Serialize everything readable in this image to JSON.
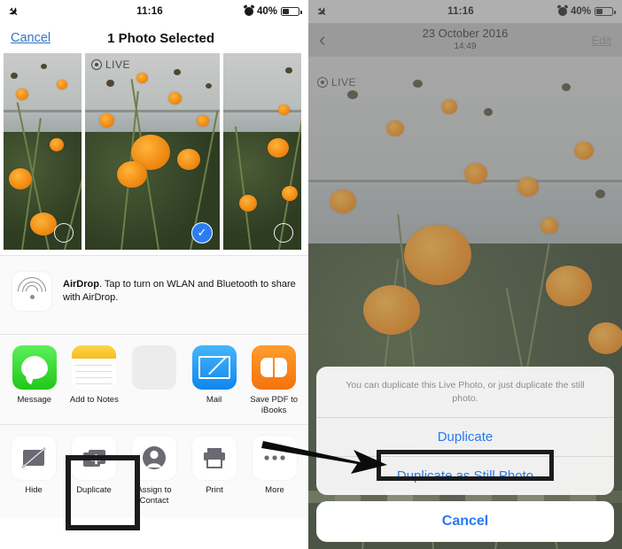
{
  "left_phone": {
    "status_bar": {
      "airplane_icon": "airplane-icon",
      "time": "11:16",
      "alarm_icon": "alarm-icon",
      "battery_percent": "40%",
      "battery_level": 40
    },
    "nav": {
      "cancel_label": "Cancel",
      "title": "1 Photo Selected"
    },
    "thumbnails": [
      {
        "name": "thumb-left",
        "selected": false,
        "live": false
      },
      {
        "name": "thumb-center",
        "selected": true,
        "live": true,
        "live_label": "LIVE"
      },
      {
        "name": "thumb-right",
        "selected": false,
        "live": false
      }
    ],
    "airdrop": {
      "title": "AirDrop",
      "description": ". Tap to turn on WLAN and Bluetooth to share with AirDrop.",
      "icon": "airdrop-icon"
    },
    "apps": [
      {
        "label": "Message",
        "icon": "message-icon"
      },
      {
        "label": "Add to Notes",
        "icon": "notes-icon"
      },
      {
        "label": "",
        "icon": "blank-app-icon"
      },
      {
        "label": "Mail",
        "icon": "mail-icon"
      },
      {
        "label": "Save PDF to iBooks",
        "icon": "ibooks-icon"
      }
    ],
    "actions": [
      {
        "label": "Hide",
        "icon": "hide-icon",
        "highlighted": false
      },
      {
        "label": "Duplicate",
        "icon": "duplicate-icon",
        "highlighted": true
      },
      {
        "label": "Assign to Contact",
        "icon": "contact-icon",
        "highlighted": false
      },
      {
        "label": "Print",
        "icon": "print-icon",
        "highlighted": false
      },
      {
        "label": "More",
        "icon": "more-icon",
        "highlighted": false
      }
    ]
  },
  "right_phone": {
    "status_bar": {
      "airplane_icon": "airplane-icon",
      "time": "11:16",
      "alarm_icon": "alarm-icon",
      "battery_percent": "40%",
      "battery_level": 40
    },
    "nav": {
      "back_icon": "chevron-left-icon",
      "date": "23 October 2016",
      "time": "14:49",
      "edit_label": "Edit"
    },
    "live_badge": "LIVE",
    "action_sheet": {
      "message": "You can duplicate this Live Photo, or just duplicate the still photo.",
      "options": [
        {
          "label": "Duplicate",
          "highlighted": false
        },
        {
          "label": "Duplicate as Still Photo",
          "highlighted": true
        }
      ],
      "cancel_label": "Cancel"
    }
  },
  "annotation": {
    "arrow": "pointer-arrow",
    "highlight_color": "#1b1b1b"
  }
}
